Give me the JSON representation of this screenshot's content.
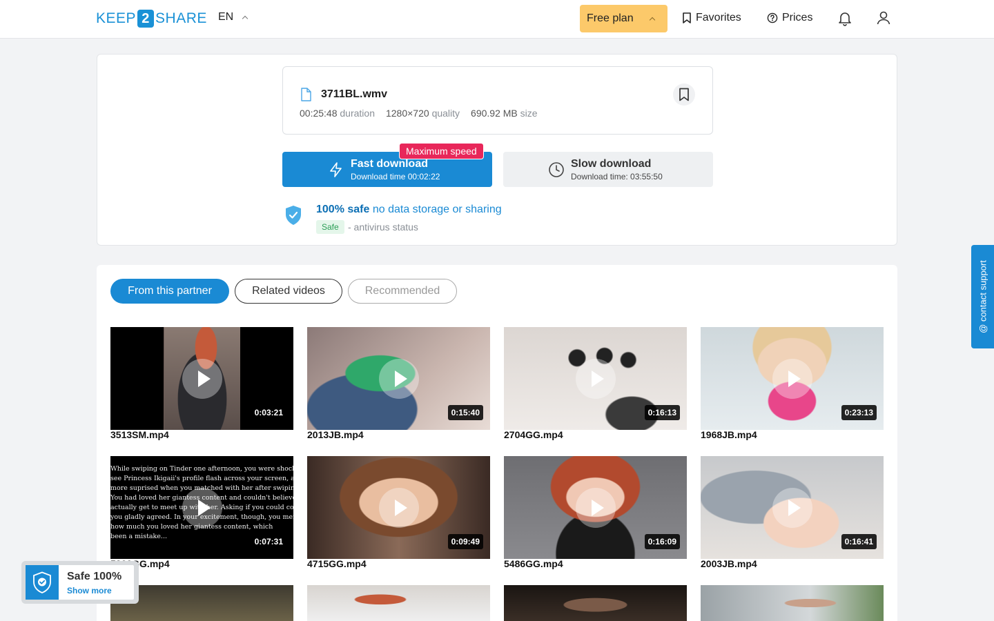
{
  "header": {
    "logo_left": "KEEP",
    "logo_num": "2",
    "logo_right": "SHARE",
    "lang": "EN",
    "plan": "Free plan",
    "favorites": "Favorites",
    "prices": "Prices"
  },
  "file": {
    "name": "3711BL.wmv",
    "duration_value": "00:25:48",
    "duration_label": "duration",
    "quality_value": "1280×720",
    "quality_label": "quality",
    "size_value": "690.92 MB",
    "size_label": "size"
  },
  "download": {
    "fast_title": "Fast download",
    "fast_time": "Download time 00:02:22",
    "max_badge": "Maximum speed",
    "slow_title": "Slow download",
    "slow_time": "Download time: 03:55:50"
  },
  "safety": {
    "title_bold": "100% safe",
    "title_rest": "no data storage or sharing",
    "tag": "Safe",
    "sub": "- antivirus status"
  },
  "tabs": {
    "partner": "From this partner",
    "related": "Related videos",
    "recommended": "Recommended"
  },
  "videos": [
    {
      "name": "3513SM.mp4",
      "duration": "0:03:21"
    },
    {
      "name": "2013JB.mp4",
      "duration": "0:15:40"
    },
    {
      "name": "2704GG.mp4",
      "duration": "0:16:13"
    },
    {
      "name": "1968JB.mp4",
      "duration": "0:23:13"
    },
    {
      "name": "5200GG.mp4",
      "duration": "0:07:31"
    },
    {
      "name": "4715GG.mp4",
      "duration": "0:09:49"
    },
    {
      "name": "5486GG.mp4",
      "duration": "0:16:09"
    },
    {
      "name": "2003JB.mp4",
      "duration": "0:16:41"
    }
  ],
  "thumb5_text": "While swiping on Tinder one afternoon, you were shocked to\nsee Princess Ikigaii's profile flash across your screen, and even\nmore suprised when you matched with her after swiping right!\nYou had loved her giantess content and couldn't believe you'd\nactually get to meet up with her. Asking if you could come over\nyou gladly agreed. In your excitement, though, you mentioned\nhow much you loved her giantess content, which\nbeen a mistake...",
  "support": "@ contact support",
  "safe_widget": {
    "title": "Safe 100%",
    "link": "Show more"
  },
  "colors": {
    "accent": "#1a8ad4",
    "plan_bg": "#fcc96a",
    "badge_red": "#e8275a"
  }
}
